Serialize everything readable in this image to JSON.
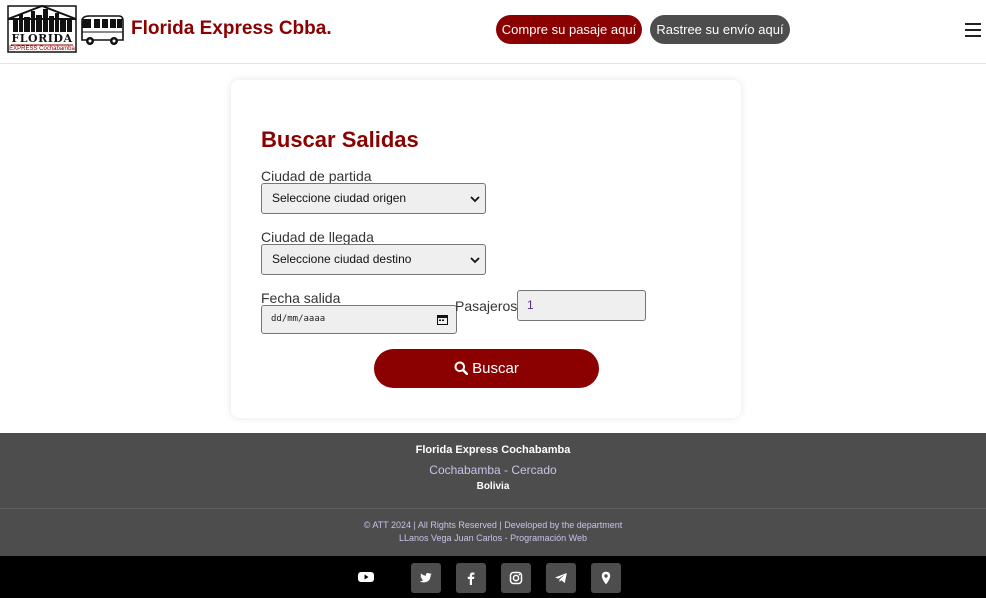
{
  "header": {
    "logo_main": "FLORIDA",
    "logo_sub": "EXPRESS Cochabamba",
    "brand_title": "Florida Express Cbba.",
    "buy_button": "Compre su pasaje aquí",
    "track_button": "Rastree su envío aquí",
    "menu_icon": "hamburger-icon"
  },
  "search_form": {
    "title": "Buscar Salidas",
    "origin_label": "Ciudad de partida",
    "origin_value": "Seleccione ciudad origen",
    "destination_label": "Ciudad de llegada",
    "destination_value": "Seleccione ciudad destino",
    "date_label": "Fecha salida",
    "date_value": "dd/mm/aaaa",
    "passengers_label": "Pasajeros",
    "passengers_value": "1",
    "search_button": "Buscar"
  },
  "footer": {
    "company": "Florida Express Cochabamba",
    "city": "Cochabamba - Cercado",
    "country": "Bolivia",
    "copyright": "© ATT 2024 | All Rights Reserved | Developed by the department",
    "developer": "LLanos Vega Juan Carlos - Programación Web"
  },
  "social": {
    "icons": [
      "youtube-icon",
      "twitter-icon",
      "facebook-icon",
      "instagram-icon",
      "telegram-icon",
      "map-pin-icon"
    ]
  },
  "colors": {
    "brand": "#8b0000",
    "dark_gray": "#4d4d4d",
    "footer_text": "#c9c3e6",
    "social_bar": "#000000"
  }
}
